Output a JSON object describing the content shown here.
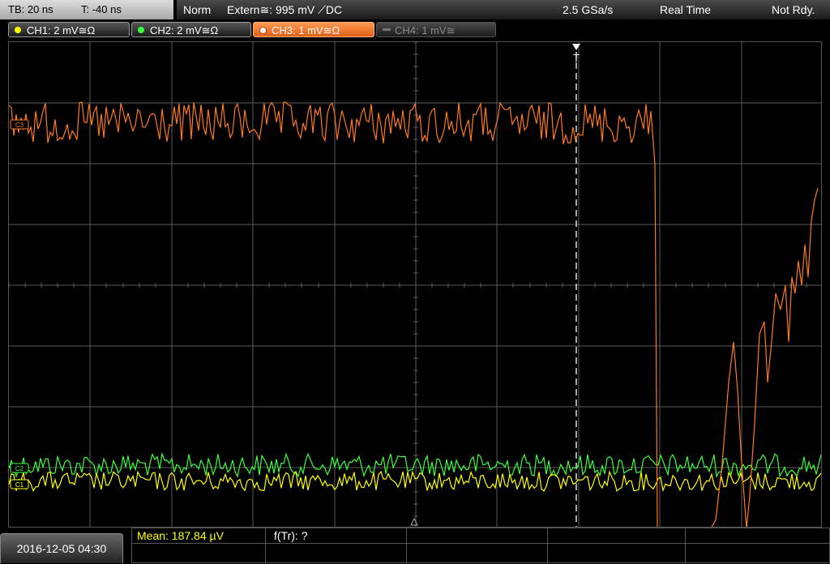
{
  "timebase": {
    "tb": "TB: 20 ns",
    "trigger_offset": "T: -40 ns"
  },
  "status_bar": {
    "mode": "Norm",
    "trigger_source": "Extern≅: 995 mV ⟋DC",
    "sample_rate": "2.5 GSa/s",
    "acq_mode": "Real Time",
    "state": "Not Rdy."
  },
  "channels": [
    {
      "label": "CH1: 2 mV≅Ω",
      "color": "#ffff00",
      "active": true
    },
    {
      "label": "CH2: 2 mV≅Ω",
      "color": "#3cff3c",
      "active": true
    },
    {
      "label": "CH3: 1 mV≅Ω",
      "color": "#ff7a1f",
      "active": true,
      "selected": true
    },
    {
      "label": "CH4: 1 mV≅",
      "color": "#8a8a8a",
      "active": false
    }
  ],
  "trigger_marker": "T",
  "channel_markers": [
    "C3",
    "C2",
    "C1"
  ],
  "datetime": "2016-12-05 04:30",
  "measurements": {
    "mean": "Mean: 187.84 µV",
    "ftr": "f(Tr): ?"
  },
  "colors": {
    "grid": "#5a5a5a",
    "trigger_line": "#ffffff",
    "mean_text": "#ffff00"
  }
}
